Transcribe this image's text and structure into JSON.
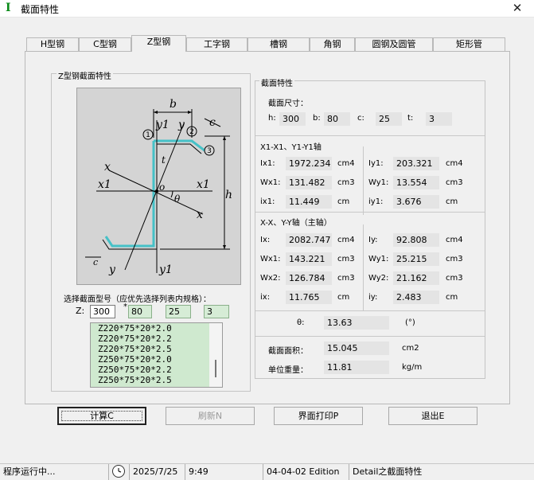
{
  "window": {
    "title": "截面特性",
    "close_glyph": "✕",
    "app_icon": "I"
  },
  "tabs": [
    {
      "label": "H型钢"
    },
    {
      "label": "C型钢"
    },
    {
      "label": "Z型钢"
    },
    {
      "label": "工字钢"
    },
    {
      "label": "槽钢"
    },
    {
      "label": "角钢"
    },
    {
      "label": "圆钢及圆管"
    },
    {
      "label": "矩形管"
    }
  ],
  "active_tab": "Z型钢",
  "diagram_group": {
    "title": "Z型钢截面特性"
  },
  "diagram_labels": {
    "b": "b",
    "c": "c",
    "h": "h",
    "t": "t",
    "o": "o",
    "theta": "θ",
    "x": "x",
    "x1": "x1",
    "y": "y",
    "y1": "y1",
    "n1": "1",
    "n2": "2",
    "n3": "3"
  },
  "select_spec": {
    "label": "选择截面型号（应优先选择列表内规格）：",
    "z_label": "Z:",
    "h_value": "300",
    "sep1": "*",
    "b_value": "80",
    "c_value": "25",
    "t_value": "3",
    "items": [
      "Z220*75*20*2.0",
      "Z220*75*20*2.2",
      "Z220*75*20*2.5",
      "Z250*75*20*2.0",
      "Z250*75*20*2.2",
      "Z250*75*20*2.5"
    ]
  },
  "properties": {
    "title": "截面特性",
    "size_label": "截面尺寸：",
    "h_label": "h:",
    "h_value": "300",
    "b_label": "b:",
    "b_value": "80",
    "c_label": "c:",
    "c_value": "25",
    "t_label": "t:",
    "t_value": "3",
    "axis1_heading": "X1-X1、Y1-Y1轴",
    "Ix1_label": "Ix1:",
    "Ix1_value": "1972.234",
    "Ix1_unit": "cm4",
    "Iy1_label": "Iy1:",
    "Iy1_value": "203.321",
    "Iy1_unit": "cm4",
    "Wx1a_label": "Wx1:",
    "Wx1a_value": "131.482",
    "Wx1a_unit": "cm3",
    "Wy1a_label": "Wy1:",
    "Wy1a_value": "13.554",
    "Wy1a_unit": "cm3",
    "ix1_label": "ix1:",
    "ix1_value": "11.449",
    "ix1_unit": "cm",
    "iy1_label": "iy1:",
    "iy1_value": "3.676",
    "iy1_unit": "cm",
    "axis2_heading": "X-X、Y-Y轴（主轴）",
    "Ix_label": "Ix:",
    "Ix_value": "2082.747",
    "Ix_unit": "cm4",
    "Iy_label": "Iy:",
    "Iy_value": "92.808",
    "Iy_unit": "cm4",
    "Wx1b_label": "Wx1:",
    "Wx1b_value": "143.221",
    "Wx1b_unit": "cm3",
    "Wy1b_label": "Wy1:",
    "Wy1b_value": "25.215",
    "Wy1b_unit": "cm3",
    "Wx2_label": "Wx2:",
    "Wx2_value": "126.784",
    "Wx2_unit": "cm3",
    "Wy2_label": "Wy2:",
    "Wy2_value": "21.162",
    "Wy2_unit": "cm3",
    "ix_label": "ix:",
    "ix_value": "11.765",
    "ix_unit": "cm",
    "iy_label": "iy:",
    "iy_value": "2.483",
    "iy_unit": "cm",
    "theta_label": "θ:",
    "theta_value": "13.63",
    "theta_unit": "(°)",
    "area_label": "截面面积：",
    "area_value": "15.045",
    "area_unit": "cm2",
    "weight_label": "单位重量：",
    "weight_value": "11.81",
    "weight_unit": "kg/m"
  },
  "buttons": {
    "calc": "计算C",
    "refresh": "刷新N",
    "print": "界面打印P",
    "exit": "退出E"
  },
  "statusbar": {
    "status": "程序运行中...",
    "date": "2025/7/25",
    "time": "9:49",
    "edition": "04-04-02 Edition",
    "detail": "Detail之截面特性"
  },
  "colors": {
    "section_highlight": "#45c1c7",
    "list_bg": "#cfe9cf",
    "app_icon": "#0a8a18"
  }
}
